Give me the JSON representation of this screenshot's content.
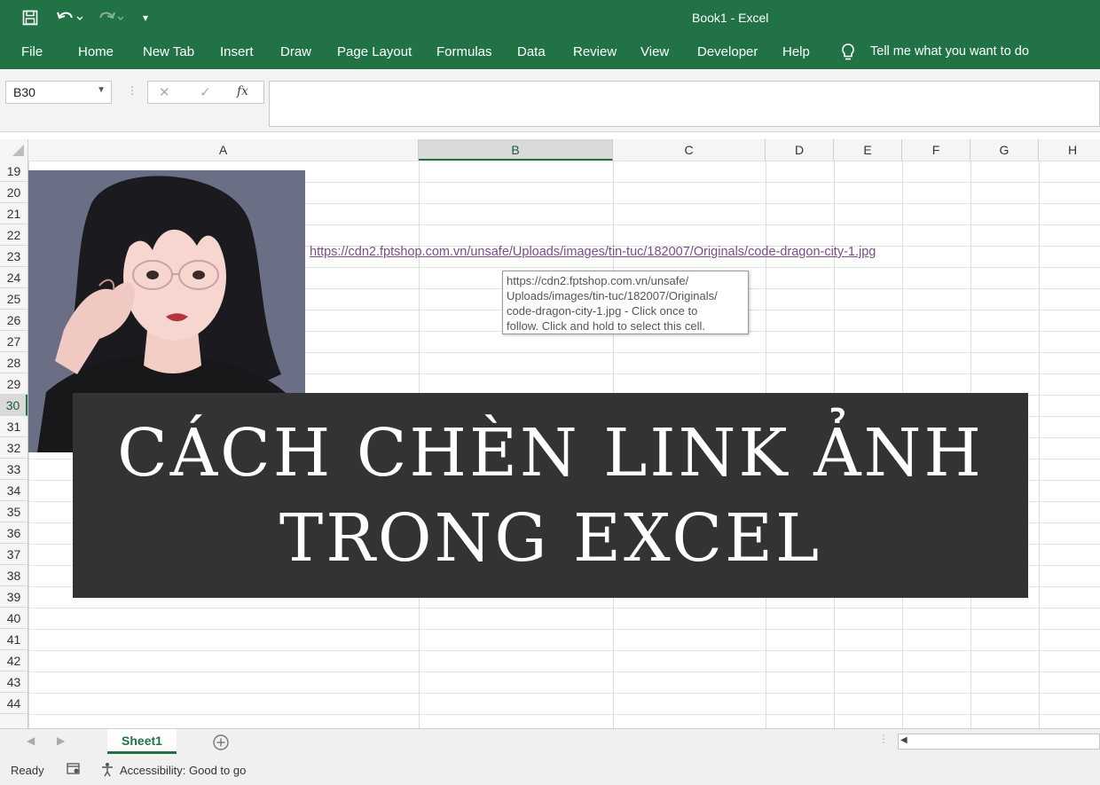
{
  "window": {
    "title": "Book1  -  Excel"
  },
  "quick_access": [
    {
      "name": "save-icon",
      "glyph": "💾"
    },
    {
      "name": "undo-icon",
      "glyph": "↶"
    },
    {
      "name": "redo-icon",
      "glyph": "↷"
    },
    {
      "name": "customize-icon",
      "glyph": "▾"
    }
  ],
  "menu": {
    "items": [
      "File",
      "Home",
      "New Tab",
      "Insert",
      "Draw",
      "Page Layout",
      "Formulas",
      "Data",
      "Review",
      "View",
      "Developer",
      "Help"
    ],
    "tell_me": "Tell me what you want to do"
  },
  "formula_bar": {
    "name_box": "B30",
    "cancel": "✕",
    "enter": "✓",
    "fx": "fx",
    "value": ""
  },
  "columns": [
    "A",
    "B",
    "C",
    "D",
    "E",
    "F",
    "G",
    "H"
  ],
  "rows": [
    "19",
    "20",
    "21",
    "22",
    "23",
    "24",
    "25",
    "26",
    "27",
    "28",
    "29",
    "30",
    "31",
    "32",
    "33",
    "34",
    "35",
    "36",
    "37",
    "38",
    "39",
    "40",
    "41",
    "42",
    "43",
    "44"
  ],
  "cell_link": "https://cdn2.fptshop.com.vn/unsafe/Uploads/images/tin-tuc/182007/Originals/code-dragon-city-1.jpg",
  "tooltip": [
    "https://cdn2.fptshop.com.vn/unsafe/",
    "Uploads/images/tin-tuc/182007/Originals/",
    "code-dragon-city-1.jpg - Click once to",
    "follow. Click and hold to select this cell."
  ],
  "banner": {
    "line1": "CÁCH CHÈN LINK ẢNH",
    "line2": "TRONG EXCEL"
  },
  "sheet_tabs": {
    "active": "Sheet1"
  },
  "status": {
    "ready": "Ready",
    "accessibility": "Accessibility: Good to go"
  },
  "colors": {
    "excel_green": "#217346",
    "banner_bg": "#333333",
    "link": "#7a4d86"
  }
}
